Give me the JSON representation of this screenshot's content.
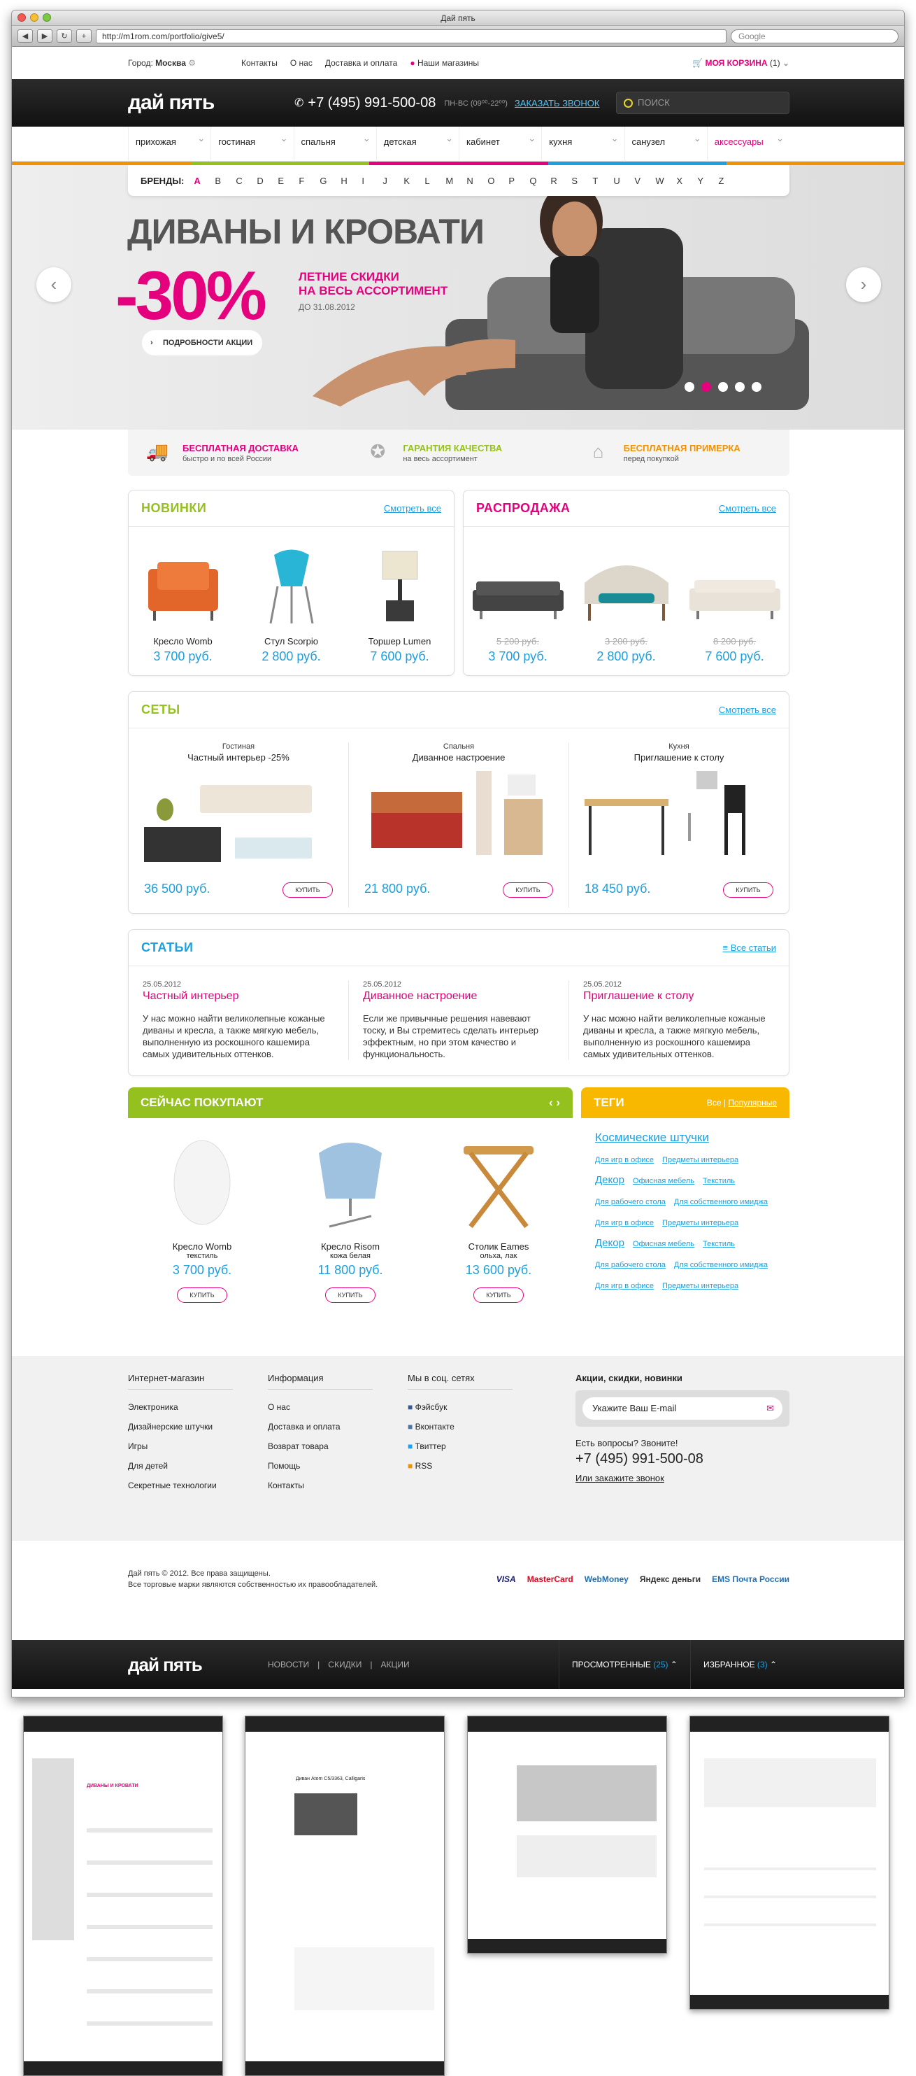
{
  "browser": {
    "title": "Дай пять",
    "url": "http://m1rom.com/portfolio/give5/",
    "search_placeholder": "Google"
  },
  "topbar": {
    "city_label": "Город:",
    "city": "Москва",
    "links": [
      "Контакты",
      "О нас",
      "Доставка и оплата",
      "Наши магазины"
    ],
    "cart": "МОЯ КОРЗИНА",
    "cart_count": "(1)"
  },
  "header": {
    "logo": "дай пять",
    "phone": "+7 (495) 991-500-08",
    "hours": "ПН-ВС (09⁰⁰-22⁰⁰)",
    "callback": "ЗАКАЗАТЬ ЗВОНОК",
    "search_placeholder": "ПОИСК"
  },
  "menu": [
    "прихожая",
    "гостиная",
    "спальня",
    "детская",
    "кабинет",
    "кухня",
    "санузел",
    "аксессуары"
  ],
  "brands": {
    "label": "БРЕНДЫ:",
    "letters": [
      "A",
      "B",
      "C",
      "D",
      "E",
      "F",
      "G",
      "H",
      "I",
      "J",
      "K",
      "L",
      "M",
      "N",
      "O",
      "P",
      "Q",
      "R",
      "S",
      "T",
      "U",
      "V",
      "W",
      "X",
      "Y",
      "Z"
    ]
  },
  "hero": {
    "title": "ДИВАНЫ И КРОВАТИ",
    "discount": "-30%",
    "sub1": "ЛЕТНИЕ СКИДКИ",
    "sub2": "НА ВЕСЬ АССОРТИМЕНТ",
    "date": "ДО 31.08.2012",
    "button": "ПОДРОБНОСТИ АКЦИИ"
  },
  "benefits": [
    {
      "title": "БЕСПЛАТНАЯ ДОСТАВКА",
      "text": "быстро и по всей России",
      "color": "#e5007d"
    },
    {
      "title": "ГАРАНТИЯ КАЧЕСТВА",
      "text": "на весь ассортимент",
      "color": "#95c11f"
    },
    {
      "title": "БЕСПЛАТНАЯ ПРИМЕРКА",
      "text": "перед покупкой",
      "color": "#f39200"
    }
  ],
  "novinki": {
    "title": "НОВИНКИ",
    "more": "Смотреть все",
    "items": [
      {
        "name": "Кресло Womb",
        "price": "3 700 руб."
      },
      {
        "name": "Стул Scorpio",
        "price": "2 800 руб."
      },
      {
        "name": "Торшер Lumen",
        "price": "7 600 руб."
      }
    ]
  },
  "sale": {
    "title": "РАСПРОДАЖА",
    "more": "Смотреть все",
    "items": [
      {
        "old": "5 200 руб.",
        "price": "3 700 руб."
      },
      {
        "old": "3 200 руб.",
        "price": "2 800 руб."
      },
      {
        "old": "8 200 руб.",
        "price": "7 600 руб."
      }
    ]
  },
  "sets": {
    "title": "СЕТЫ",
    "more": "Смотреть все",
    "buy": "КУПИТЬ",
    "items": [
      {
        "cat": "Гостиная",
        "name": "Частный интерьер -25%",
        "price": "36 500 руб."
      },
      {
        "cat": "Спальня",
        "name": "Диванное настроение",
        "price": "21 800 руб."
      },
      {
        "cat": "Кухня",
        "name": "Приглашение к столу",
        "price": "18 450 руб."
      }
    ]
  },
  "articles": {
    "title": "СТАТЬИ",
    "more": "Все статьи",
    "items": [
      {
        "date": "25.05.2012",
        "title": "Частный интерьер",
        "text": "У нас можно найти великолепные кожаные диваны и кресла, а также мягкую мебель, выполненную из роскошного кашемира самых удивительных оттенков."
      },
      {
        "date": "25.05.2012",
        "title": "Диванное настроение",
        "text": "Если же привычные решения навевают тоску, и Вы стремитесь сделать интерьер эффектным, но при этом качество и функциональность."
      },
      {
        "date": "25.05.2012",
        "title": "Приглашение к столу",
        "text": "У нас можно найти великолепные кожаные диваны и кресла, а также мягкую мебель, выполненную из роскошного кашемира самых удивительных оттенков."
      }
    ]
  },
  "buying": {
    "title": "СЕЙЧАС ПОКУПАЮТ",
    "buy": "КУПИТЬ",
    "items": [
      {
        "name": "Кресло Womb",
        "sub": "текстиль",
        "price": "3 700 руб."
      },
      {
        "name": "Кресло Risom",
        "sub": "кожа белая",
        "price": "11 800 руб."
      },
      {
        "name": "Столик Eames",
        "sub": "ольха, лак",
        "price": "13 600 руб."
      }
    ]
  },
  "tags": {
    "title": "ТЕГИ",
    "all": "Все",
    "popular": "Популярные",
    "lines": [
      [
        "Космические штучки"
      ],
      [
        "Для игр в офисе",
        "Предметы интерьера"
      ],
      [
        "Декор",
        "Офисная мебель",
        "Текстиль"
      ],
      [
        "Для рабочего стола",
        "Для собственного имиджа"
      ],
      [
        "Для игр в офисе",
        "Предметы интерьера"
      ],
      [
        "Декор",
        "Офисная мебель",
        "Текстиль"
      ],
      [
        "Для рабочего стола",
        "Для собственного имиджа"
      ],
      [
        "Для игр в офисе",
        "Предметы интерьера"
      ]
    ]
  },
  "footer": {
    "cols": [
      {
        "title": "Интернет-магазин",
        "links": [
          "Электроника",
          "Дизайнерские штучки",
          "Игры",
          "Для детей",
          "Секретные технологии"
        ]
      },
      {
        "title": "Информация",
        "links": [
          "О нас",
          "Доставка и оплата",
          "Возврат товара",
          "Помощь",
          "Контакты"
        ]
      },
      {
        "title": "Мы в соц. сетях",
        "links": [
          "Фэйсбук",
          "Вконтакте",
          "Твиттер",
          "RSS"
        ]
      }
    ],
    "subscribe_title": "Акции, скидки, новинки",
    "email_placeholder": "Укажите Ваш E-mail",
    "question": "Есть вопросы? Звоните!",
    "phone": "+7 (495) 991-500-08",
    "order_call": "Или закажите звонок",
    "copy1": "Дай пять © 2012. Все права защищены.",
    "copy2": "Все торговые марки являются собственностью их правообладателей.",
    "payments": [
      "VISA",
      "MasterCard",
      "WebMoney",
      "Яндекс деньги",
      "EMS Почта России"
    ]
  },
  "bottombar": {
    "logo": "дай пять",
    "links": [
      "НОВОСТИ",
      "СКИДКИ",
      "АКЦИИ"
    ],
    "viewed": "ПРОСМОТРЕННЫЕ",
    "viewed_count": "(25)",
    "fav": "ИЗБРАННОЕ",
    "fav_count": "(3)"
  },
  "thumbnails": {
    "t1": "ДИВАНЫ И КРОВАТИ",
    "t2": "Диван Atom C5/3363, Calligaris"
  }
}
